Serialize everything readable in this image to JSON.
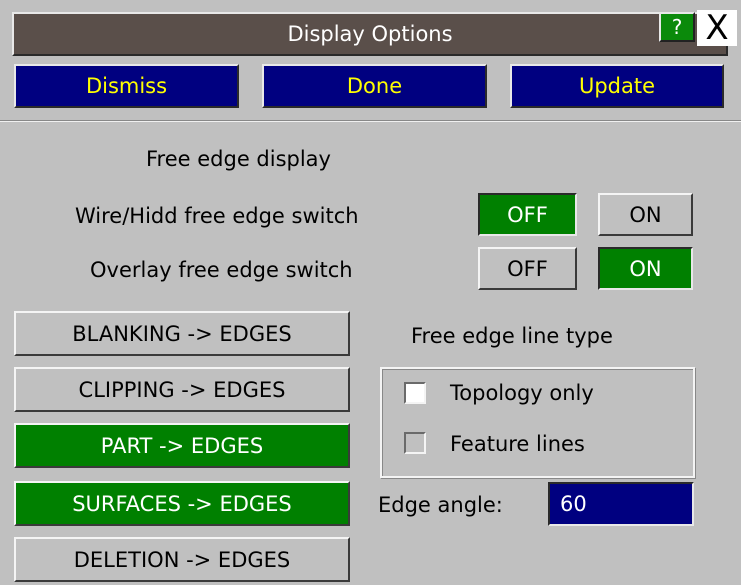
{
  "window": {
    "title": "Display Options",
    "help_label": "?",
    "close_label": "X"
  },
  "actions": {
    "dismiss": "Dismiss",
    "done": "Done",
    "update": "Update"
  },
  "free_edge": {
    "heading": "Free edge display",
    "wire_hidd_label": "Wire/Hidd free edge switch",
    "wire_hidd_off": "OFF",
    "wire_hidd_on": "ON",
    "wire_hidd_state": "OFF",
    "overlay_label": "Overlay free edge switch",
    "overlay_off": "OFF",
    "overlay_on": "ON",
    "overlay_state": "ON"
  },
  "edge_buttons": [
    {
      "label": "BLANKING -> EDGES",
      "active": false
    },
    {
      "label": "CLIPPING -> EDGES",
      "active": false
    },
    {
      "label": "PART -> EDGES",
      "active": true
    },
    {
      "label": "SURFACES -> EDGES",
      "active": true
    },
    {
      "label": "DELETION -> EDGES",
      "active": false
    }
  ],
  "line_type": {
    "heading": "Free edge line type",
    "topology_label": "Topology only",
    "topology_checked": false,
    "feature_label": "Feature lines",
    "feature_checked": false
  },
  "edge_angle": {
    "label": "Edge angle:",
    "value": "60"
  },
  "colors": {
    "panel_bg": "#c0c0c0",
    "titlebar_bg": "#5a4f4a",
    "action_bg": "#000080",
    "action_text": "#ffff00",
    "active_green": "#008000"
  }
}
